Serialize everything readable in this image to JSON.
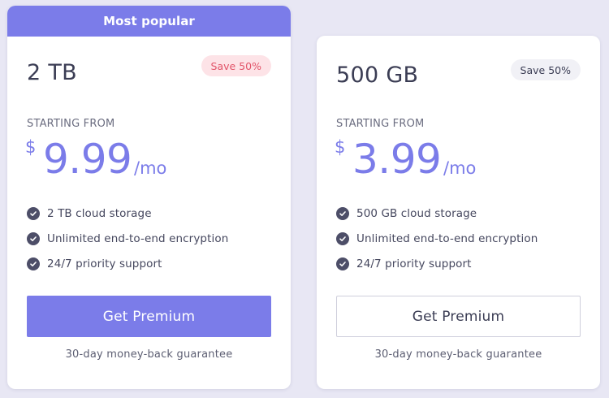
{
  "plans": [
    {
      "ribbon": "Most popular",
      "name": "2 TB",
      "badge": "Save 50%",
      "starting_label": "STARTING FROM",
      "currency": "$",
      "price": "9.99",
      "period": "/mo",
      "features": [
        "2 TB cloud storage",
        "Unlimited end-to-end encryption",
        "24/7 priority support"
      ],
      "cta": "Get Premium",
      "guarantee": "30-day money-back guarantee"
    },
    {
      "name": "500 GB",
      "badge": "Save 50%",
      "starting_label": "STARTING FROM",
      "currency": "$",
      "price": "3.99",
      "period": "/mo",
      "features": [
        "500 GB cloud storage",
        "Unlimited end-to-end encryption",
        "24/7 priority support"
      ],
      "cta": "Get Premium",
      "guarantee": "30-day money-back guarantee"
    }
  ],
  "colors": {
    "accent": "#7b7ce9",
    "badge_highlight_bg": "#fde3e7",
    "badge_highlight_text": "#e25469",
    "check_icon": "#4d4e68",
    "page_background": "#e8e7f4"
  },
  "icons": {
    "feature": "check-circle-icon"
  }
}
